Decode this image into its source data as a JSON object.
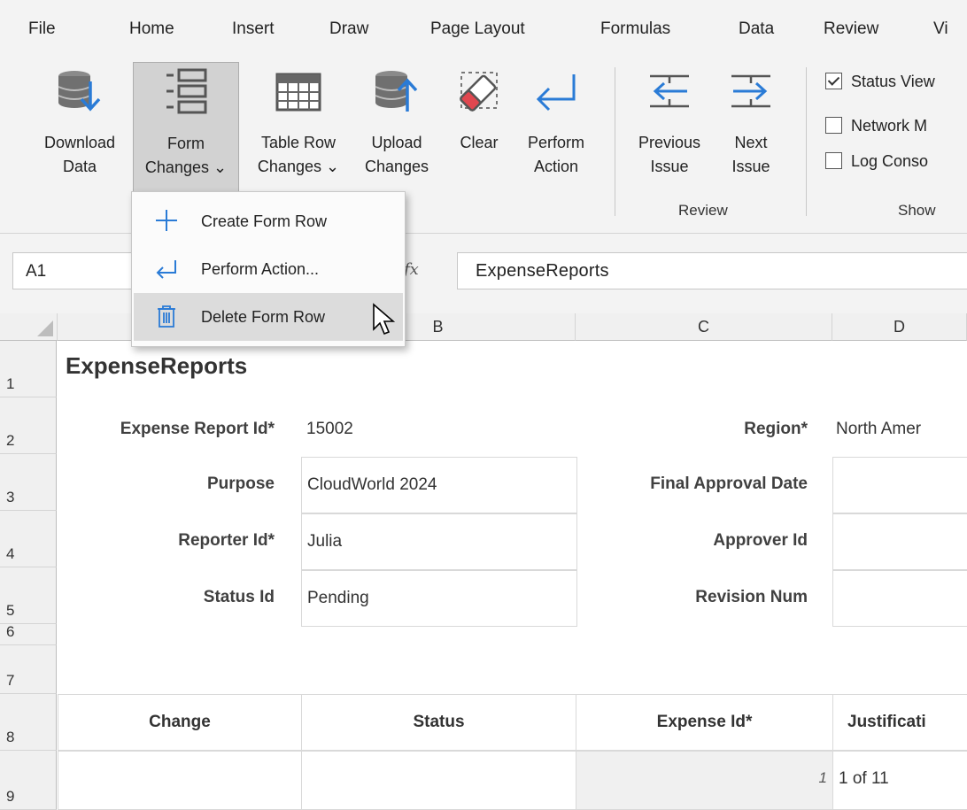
{
  "menu": {
    "tabs": [
      "File",
      "Home",
      "Insert",
      "Draw",
      "Page Layout",
      "Formulas",
      "Data",
      "Review",
      "Vi"
    ]
  },
  "ribbon": {
    "buttons": [
      {
        "line1": "Download",
        "line2": "Data",
        "icon": "database-download-icon"
      },
      {
        "line1": "Form",
        "line2": "Changes ⌄",
        "icon": "form-rows-icon"
      },
      {
        "line1": "Table Row",
        "line2": "Changes ⌄",
        "icon": "table-grid-icon"
      },
      {
        "line1": "Upload",
        "line2": "Changes",
        "icon": "database-upload-icon"
      },
      {
        "line1": "Clear",
        "line2": "",
        "icon": "eraser-icon"
      },
      {
        "line1": "Perform",
        "line2": "Action",
        "icon": "return-arrow-icon"
      },
      {
        "line1": "Previous",
        "line2": "Issue",
        "icon": "previous-issue-icon"
      },
      {
        "line1": "Next",
        "line2": "Issue",
        "icon": "next-issue-icon"
      }
    ],
    "groups": {
      "review": "Review",
      "show": "Show"
    },
    "checkboxes": [
      {
        "label": "Status View",
        "checked": true
      },
      {
        "label": "Network M",
        "checked": false
      },
      {
        "label": "Log Conso",
        "checked": false
      }
    ]
  },
  "dropdown": {
    "items": [
      {
        "label": "Create Form Row",
        "icon": "plus-icon"
      },
      {
        "label": "Perform Action...",
        "icon": "return-arrow-icon"
      },
      {
        "label": "Delete Form Row",
        "icon": "trash-icon"
      }
    ]
  },
  "formula_bar": {
    "name_box": "A1",
    "fx": "fx",
    "value": "ExpenseReports"
  },
  "grid": {
    "columns": [
      "B",
      "C",
      "D"
    ],
    "rows": [
      "1",
      "2",
      "3",
      "4",
      "5",
      "6",
      "7",
      "8",
      "9"
    ],
    "title": "ExpenseReports",
    "fields": [
      {
        "label": "Expense Report Id*",
        "value": "15002"
      },
      {
        "label": "Purpose",
        "value": "CloudWorld 2024"
      },
      {
        "label": "Reporter Id*",
        "value": "Julia"
      },
      {
        "label": "Status Id",
        "value": "Pending"
      }
    ],
    "fields_right": [
      {
        "label": "Region*",
        "value": "North Amer"
      },
      {
        "label": "Final Approval Date",
        "value": ""
      },
      {
        "label": "Approver Id",
        "value": ""
      },
      {
        "label": "Revision Num",
        "value": ""
      }
    ],
    "table_headers": [
      "Change",
      "Status",
      "Expense Id*",
      "Justificati"
    ],
    "row9": {
      "expense_id": "1",
      "justification": "1 of 11"
    }
  }
}
